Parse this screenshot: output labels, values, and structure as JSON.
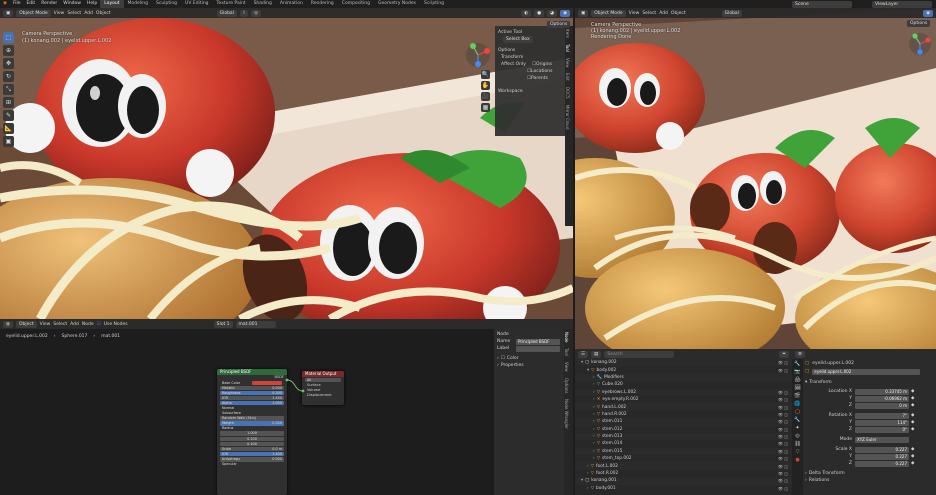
{
  "topbar": {
    "menus": [
      "File",
      "Edit",
      "Render",
      "Window",
      "Help"
    ],
    "workspaces": [
      "Layout",
      "Modeling",
      "Sculpting",
      "UV Editing",
      "Texture Paint",
      "Shading",
      "Animation",
      "Rendering",
      "Compositing",
      "Geometry Nodes",
      "Scripting"
    ],
    "active_workspace": "Layout",
    "scene": "Scene",
    "view_layer": "ViewLayer"
  },
  "viewport_left": {
    "mode": "Object Mode",
    "menus": [
      "View",
      "Select",
      "Add",
      "Object"
    ],
    "orientation": "Global",
    "camera_label": "Camera Perspective",
    "object_label": "(1) konang.002 | eyelid.upper.L.002",
    "options": "Options"
  },
  "tool_panel": {
    "active_tool_title": "Active Tool",
    "select_box": "Select Box",
    "options_title": "Options",
    "transform_title": "Transform",
    "affect_only": "Affect Only",
    "origins": "Origins",
    "locations": "Locations",
    "parents": "Parents",
    "workspace_title": "Workspace",
    "tabs": [
      "Item",
      "Tool",
      "View",
      "Edit",
      "DOC5",
      "Mirror Cloud"
    ]
  },
  "viewport_right": {
    "mode": "Object Mode",
    "menus": [
      "View",
      "Select",
      "Add",
      "Object"
    ],
    "orientation": "Global",
    "camera_label": "Camera Perspective",
    "object_label": "(1) konang.002 | eyelid.upper.L.002",
    "status": "Rendering Done",
    "options": "Options"
  },
  "node_editor": {
    "type": "Object",
    "menus": [
      "View",
      "Select",
      "Add",
      "Node"
    ],
    "use_nodes": "Use Nodes",
    "slot": "Slot 1",
    "material": "mat.001",
    "breadcrumb": [
      "eyelid.upper.L.002",
      "Sphere.017",
      "mat.001"
    ],
    "principled": {
      "title": "Principled BSDF",
      "output_label": "BSDF",
      "fields": [
        {
          "label": "Base Color",
          "value": ""
        },
        {
          "label": "Metallic",
          "value": "0.000"
        },
        {
          "label": "Roughness",
          "value": "0.300"
        },
        {
          "label": "IOR",
          "value": "1.450"
        },
        {
          "label": "Alpha",
          "value": "1.000"
        },
        {
          "label": "Normal",
          "value": ""
        },
        {
          "label": "Subsurface",
          "value": ""
        },
        {
          "label": "Random Walk (Skin)",
          "value": ""
        },
        {
          "label": "Weight",
          "value": "0.000"
        },
        {
          "label": "Radius",
          "value": ""
        },
        {
          "label": "",
          "value": "1.000"
        },
        {
          "label": "",
          "value": "0.200"
        },
        {
          "label": "",
          "value": "0.100"
        },
        {
          "label": "Scale",
          "value": "0.0 m"
        },
        {
          "label": "IOR",
          "value": "1.400"
        },
        {
          "label": "Anisotropy",
          "value": "0.000"
        },
        {
          "label": "Specular",
          "value": ""
        }
      ]
    },
    "output": {
      "title": "Material Output",
      "target": "All",
      "sockets": [
        "Surface",
        "Volume",
        "Displacement"
      ]
    }
  },
  "node_sidebar": {
    "title": "Node",
    "name_label": "Name",
    "name_value": "Principled BSDF",
    "label_label": "Label",
    "color_label": "Color",
    "properties_label": "Properties",
    "tabs": [
      "Node",
      "Tool",
      "View",
      "Options",
      "Node Wrangler"
    ]
  },
  "outliner": {
    "search_placeholder": "Search",
    "items": [
      {
        "name": "konang.002",
        "depth": 0
      },
      {
        "name": "body.002",
        "depth": 1
      },
      {
        "name": "Modifiers",
        "depth": 2
      },
      {
        "name": "Cube.020",
        "depth": 2
      },
      {
        "name": "eyebrows.L.002",
        "depth": 2
      },
      {
        "name": "eye.empty.R.002",
        "depth": 2
      },
      {
        "name": "hand.L.002",
        "depth": 2
      },
      {
        "name": "hand.R.002",
        "depth": 2
      },
      {
        "name": "stem.011",
        "depth": 2
      },
      {
        "name": "stem.012",
        "depth": 2
      },
      {
        "name": "stem.013",
        "depth": 2
      },
      {
        "name": "stem.014",
        "depth": 2
      },
      {
        "name": "stem.015",
        "depth": 2
      },
      {
        "name": "stem_top.002",
        "depth": 2
      },
      {
        "name": "foot.L.002",
        "depth": 1
      },
      {
        "name": "foot.R.002",
        "depth": 1
      },
      {
        "name": "konang.001",
        "depth": 0
      },
      {
        "name": "body.001",
        "depth": 1
      }
    ]
  },
  "properties": {
    "object_name": "eyelid.upper.L.002",
    "object_field": "eyelid.upper.L.002",
    "transform_title": "Transform",
    "location_label": "Location X",
    "location": [
      "0.33745 m",
      "-0.06962 m",
      "0 m"
    ],
    "rotation_label": "Rotation X",
    "rotation": [
      "7°",
      "114°",
      "0°"
    ],
    "mode_label": "Mode",
    "mode_value": "XYZ Euler",
    "scale_label": "Scale X",
    "scale": [
      "0.227",
      "0.227",
      "0.227"
    ],
    "delta_title": "Delta Transform",
    "relations_title": "Relations",
    "axis_y": "Y",
    "axis_z": "Z"
  },
  "colors": {
    "accent": "#4772b3",
    "header": "#2b2b2b",
    "node_principled": "#2d6b3a",
    "node_output": "#7a2a2a",
    "base_color": "#d2443a"
  }
}
